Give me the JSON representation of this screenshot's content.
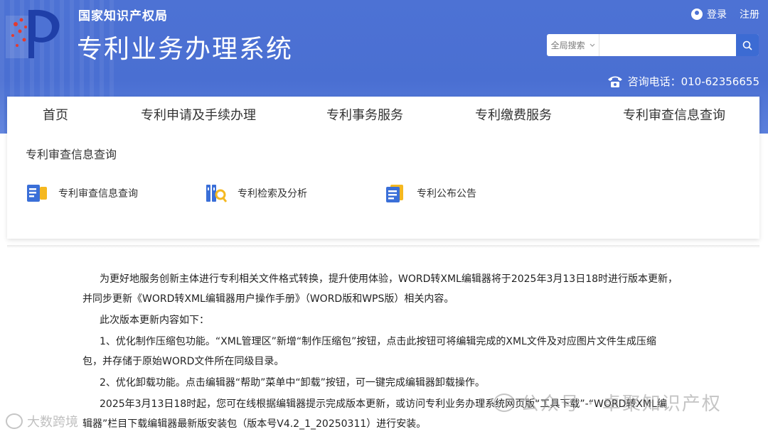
{
  "header": {
    "org_name": "国家知识产权局",
    "system_title": "专利业务办理系统",
    "login": "登录",
    "register": "注册",
    "search": {
      "scope": "全局搜索",
      "placeholder": ""
    },
    "phone_text": "咨询电话：010-62356655"
  },
  "nav": {
    "items": [
      "首页",
      "专利申请及手续办理",
      "专利事务服务",
      "专利缴费服务",
      "专利审查信息查询"
    ]
  },
  "submenu": {
    "title": "专利审查信息查询",
    "items": [
      "专利审查信息查询",
      "专利检索及分析",
      "专利公布公告"
    ]
  },
  "article": {
    "lines": [
      "为更好地服务创新主体进行专利相关文件格式转换，提升使用体验，WORD转XML编辑器将于2025年3月13日18时进行版本更新，",
      "并同步更新《WORD转XML编辑器用户操作手册》（WORD版和WPS版）相关内容。",
      "此次版本更新内容如下：",
      "1、优化制作压缩包功能。“XML管理区”新增“制作压缩包”按钮，点击此按钮可将编辑完成的XML文件及对应图片文件生成压缩",
      "包，并存储于原始WORD文件所在同级目录。",
      "2、优化卸载功能。点击编辑器“帮助”菜单中“卸载”按钮，可一键完成编辑器卸载操作。",
      "2025年3月13日18时起，您可在线根据编辑器提示完成版本更新，或访问专利业务办理系统网页版“工具下载”-“WORD转XML编",
      "辑器”栏目下载编辑器最新版安装包（版本号V4.2_1_20250311）进行安装。"
    ]
  },
  "watermarks": {
    "right": "公众号 · 卓聚知识产权",
    "left": "大数跨境"
  },
  "colors": {
    "header_blue": "#4d72d4",
    "search_button": "#3c6bd3",
    "icon_blue": "#3a6fd8",
    "icon_yellow": "#f5b820"
  }
}
